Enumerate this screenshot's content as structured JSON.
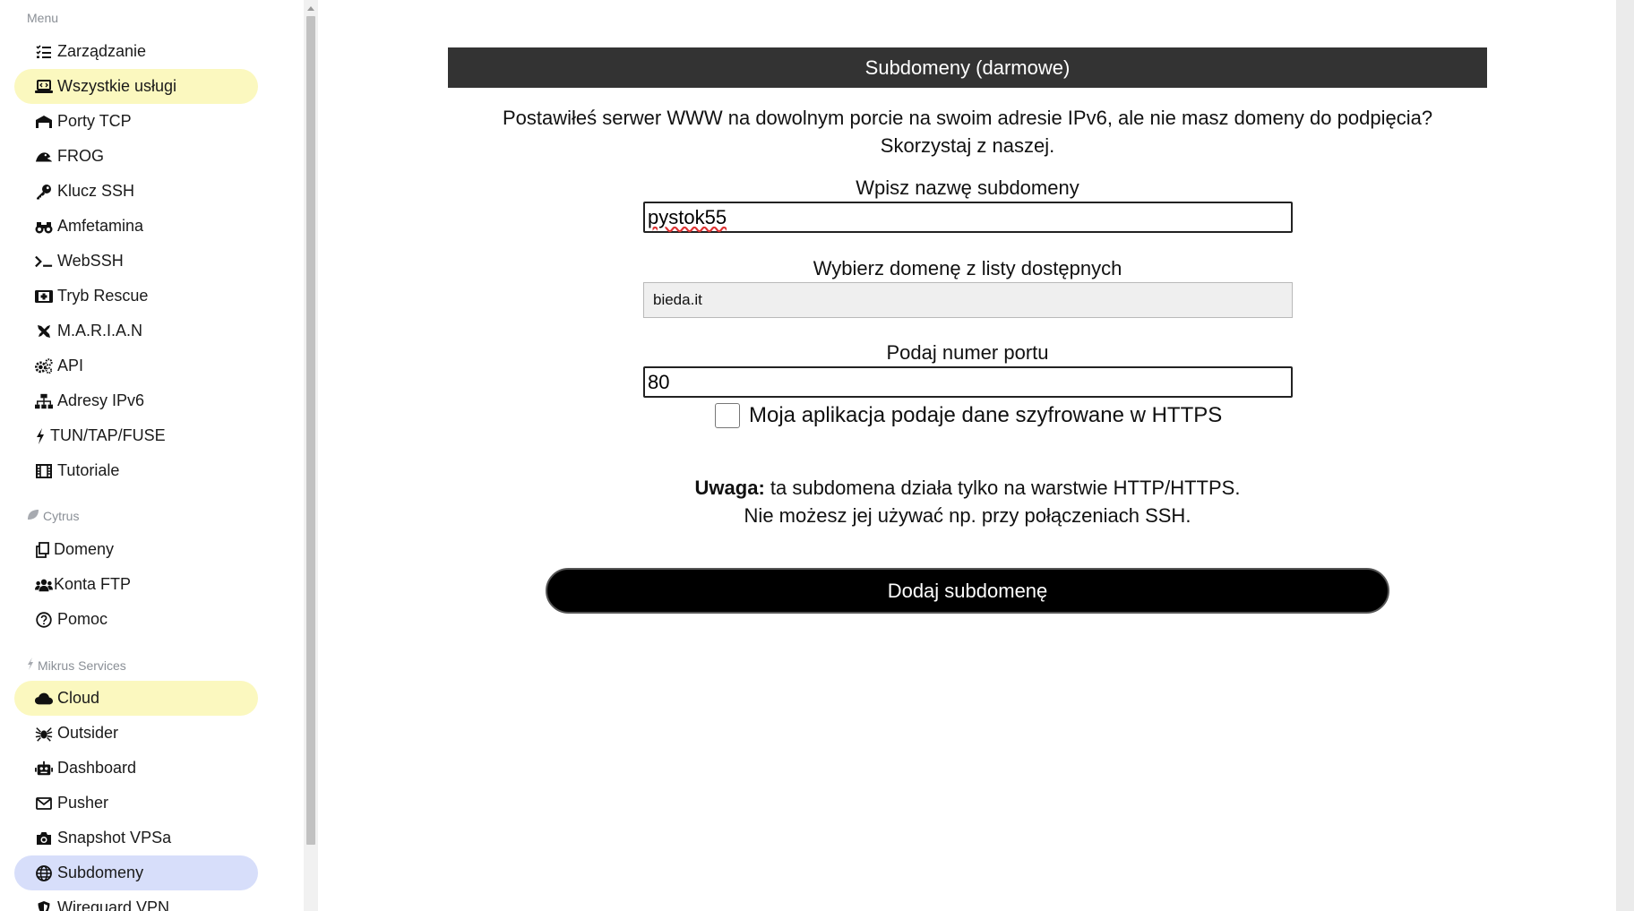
{
  "sidebar": {
    "sections": [
      {
        "label": "Menu",
        "items": [
          {
            "label": "Zarządzanie",
            "icon": "list-check-icon"
          },
          {
            "label": "Wszystkie usługi",
            "icon": "laptop-code-icon"
          },
          {
            "label": "Porty TCP",
            "icon": "network-wired-icon"
          },
          {
            "label": "FROG",
            "icon": "frog-icon"
          },
          {
            "label": "Klucz SSH",
            "icon": "key-icon"
          },
          {
            "label": "Amfetamina",
            "icon": "binoculars-icon"
          },
          {
            "label": "WebSSH",
            "icon": "terminal-icon"
          },
          {
            "label": "Tryb Rescue",
            "icon": "first-aid-icon"
          },
          {
            "label": "M.A.R.I.A.N",
            "icon": "tools-icon"
          },
          {
            "label": "API",
            "icon": "cogs-icon"
          },
          {
            "label": "Adresy IPv6",
            "icon": "sitemap-icon"
          },
          {
            "label": "TUN/TAP/FUSE",
            "icon": "bolt-icon"
          },
          {
            "label": "Tutoriale",
            "icon": "film-icon"
          }
        ]
      },
      {
        "label": "Cytrus",
        "icon": "leaf-icon",
        "items": [
          {
            "label": "Domeny",
            "icon": "copy-icon"
          },
          {
            "label": "Konta FTP",
            "icon": "users-icon"
          },
          {
            "label": "Pomoc",
            "icon": "question-circle-icon"
          }
        ]
      },
      {
        "label": "Mikrus Services",
        "icon": "bolt-icon",
        "items": [
          {
            "label": "Cloud",
            "icon": "cloud-icon"
          },
          {
            "label": "Outsider",
            "icon": "spider-icon"
          },
          {
            "label": "Dashboard",
            "icon": "robot-icon"
          },
          {
            "label": "Pusher",
            "icon": "envelope-icon"
          },
          {
            "label": "Snapshot VPSa",
            "icon": "camera-icon"
          },
          {
            "label": "Subdomeny",
            "icon": "globe-icon"
          },
          {
            "label": "Wireguard VPN",
            "icon": "shield-icon"
          }
        ]
      }
    ]
  },
  "main": {
    "header": "Subdomeny (darmowe)",
    "intro_line1": "Postawiłeś serwer WWW na dowolnym porcie na swoim adresie IPv6, ale nie masz domeny do podpięcia?",
    "intro_line2": "Skorzystaj z naszej.",
    "subdomain_label": "Wpisz nazwę subdomeny",
    "subdomain_value": "pystok55",
    "domain_label": "Wybierz domenę z listy dostępnych",
    "domain_selected": "bieda.it",
    "port_label": "Podaj numer portu",
    "port_value": "80",
    "https_label": "Moja aplikacja podaje dane szyfrowane w HTTPS",
    "https_checked": false,
    "warning_bold": "Uwaga:",
    "warning_line1": " ta subdomena działa tylko na warstwie HTTP/HTTPS.",
    "warning_line2": "Nie możesz jej używać np. przy połączeniach SSH.",
    "submit_label": "Dodaj subdomenę"
  },
  "colors": {
    "header_bg": "#333333",
    "active_item_bg": "#d7defa",
    "highlight_item_bg": "#fbf8bf",
    "button_bg": "#000000"
  }
}
